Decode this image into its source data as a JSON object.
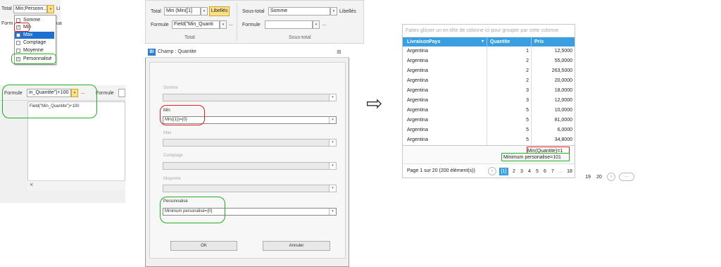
{
  "panel1": {
    "total_label": "Total",
    "total_value": "Min;Personn...",
    "libelles_label": "Li",
    "formule_label": "Form",
    "formule_fragment": "ua",
    "menu": [
      "Somme",
      "Min",
      "Max",
      "Comptage",
      "Moyenne",
      "Personnalisé"
    ],
    "menu_checked": [
      false,
      true,
      false,
      false,
      false,
      true
    ],
    "menu_selected_index": 2
  },
  "panel2": {
    "formule_label": "Formule",
    "formule_value": "in_Quantite\")+100",
    "formule_label2": "Formule",
    "ellipsis": "...",
    "formula_text": "Field(\"Min_Quantite\")+100",
    "close_glyph": "×"
  },
  "ribbon": {
    "total_label": "Total",
    "total_value": "Min (Min([1]",
    "libelles_btn": "Libellés",
    "formule_label": "Formule",
    "formule_value": "Field(\"Min_Quanti",
    "ellipsis": "...",
    "group_total": "Total",
    "soustotal_label": "Sous-total",
    "soustotal_value": "Somme",
    "libelles_label": "Libellés",
    "formule2_label": "Formule",
    "group_soustotal": "Sous-total"
  },
  "dialog": {
    "icon_text": "BI",
    "title": "Champ : Quantite",
    "close_glyph": "⊠",
    "fields": [
      {
        "label": "Somme",
        "value": "",
        "active": false
      },
      {
        "label": "Min",
        "value": "Min({1})={0}",
        "active": true
      },
      {
        "label": "Max",
        "value": "",
        "active": false
      },
      {
        "label": "Comptage",
        "value": "",
        "active": false
      },
      {
        "label": "Moyenne",
        "value": "",
        "active": false
      },
      {
        "label": "Personnalisé",
        "value": "Minimum personalisé={0}",
        "active": true
      }
    ],
    "ok_label": "OK",
    "cancel_label": "Annuler"
  },
  "arrow_glyph": "⇨",
  "grid": {
    "group_panel_text": "Faites glisser un en-tête de colonne ici pour grouper par cette colonne",
    "columns": [
      "LivraisonPays",
      "Quantite",
      "Prix"
    ],
    "rows": [
      [
        "Argentina",
        "1",
        "12,5000"
      ],
      [
        "Argentina",
        "2",
        "55,0000"
      ],
      [
        "Argentina",
        "2",
        "263,5000"
      ],
      [
        "Argentina",
        "2",
        "20,0000"
      ],
      [
        "Argentina",
        "3",
        "18,0000"
      ],
      [
        "Argentina",
        "3",
        "12,0000"
      ],
      [
        "Argentina",
        "5",
        "10,0000"
      ],
      [
        "Argentina",
        "5",
        "81,0000"
      ],
      [
        "Argentina",
        "5",
        "6,0000"
      ],
      [
        "Argentina",
        "5",
        "34,8000"
      ]
    ],
    "summary_min": "Min(Quantite)=1",
    "summary_custom": "Minimum personalise=101",
    "pager_info": "Page 1 sur 20 (200 élément(s))",
    "pager_prev": "‹",
    "pager_current": "[1]",
    "pager_pages": [
      "2",
      "3",
      "4",
      "5",
      "6",
      "7"
    ],
    "pager_dots": "...",
    "pager_tail": [
      "18",
      "19",
      "20"
    ],
    "pager_next": "›",
    "pager_more": "···"
  },
  "colors": {
    "accent_red": "#e02020",
    "accent_green": "#21b021",
    "grid_header": "#3a9fe0",
    "pager_current": "#3a9fe0"
  }
}
